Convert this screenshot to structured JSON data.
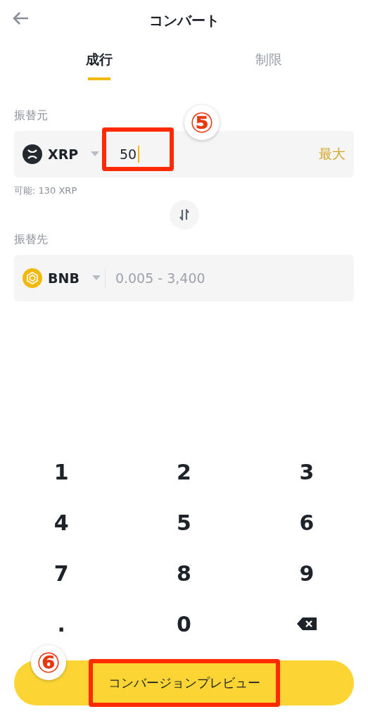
{
  "header": {
    "title": "コンバート"
  },
  "tabs": [
    {
      "label": "成行",
      "selected": true
    },
    {
      "label": "制限",
      "selected": false
    }
  ],
  "from": {
    "label": "振替元",
    "coin": "XRP",
    "value": "50",
    "max": "最大",
    "available": "可能: 130 XRP"
  },
  "to": {
    "label": "振替先",
    "coin": "BNB",
    "placeholder": "0.005 - 3,400"
  },
  "keypad": [
    {
      "kind": "digit",
      "label": "1"
    },
    {
      "kind": "digit",
      "label": "2"
    },
    {
      "kind": "digit",
      "label": "3"
    },
    {
      "kind": "digit",
      "label": "4"
    },
    {
      "kind": "digit",
      "label": "5"
    },
    {
      "kind": "digit",
      "label": "6"
    },
    {
      "kind": "digit",
      "label": "7"
    },
    {
      "kind": "digit",
      "label": "8"
    },
    {
      "kind": "digit",
      "label": "9"
    },
    {
      "kind": "digit",
      "label": "."
    },
    {
      "kind": "digit",
      "label": "0"
    },
    {
      "kind": "backspace"
    }
  ],
  "submit": {
    "label": "コンバージョンプレビュー"
  },
  "annotations": [
    {
      "label": "⑤"
    },
    {
      "label": "⑥"
    }
  ]
}
